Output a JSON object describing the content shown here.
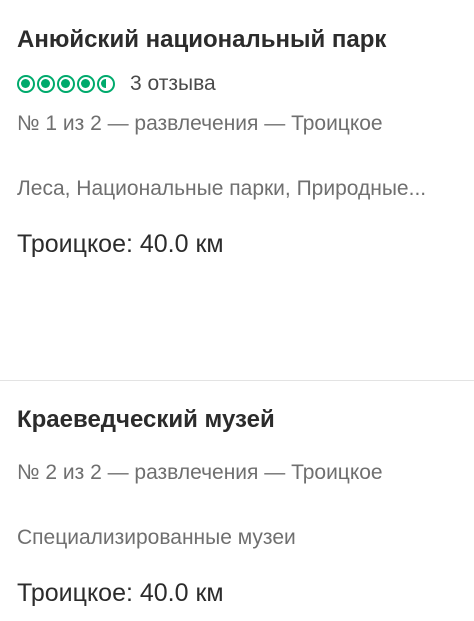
{
  "places": [
    {
      "title": "Анюйский национальный парк",
      "rating": 4.5,
      "rating_max": 5,
      "reviews": "3 отзыва",
      "rank": "№ 1 из 2 — развлечения — Троицкое",
      "tags": "Леса, Национальные парки, Природные...",
      "distance": "Троицкое: 40.0 км"
    },
    {
      "title": "Краеведческий музей",
      "rank": "№ 2 из 2 — развлечения — Троицкое",
      "tags": "Специализированные музеи",
      "distance": "Троицкое: 40.0 км"
    }
  ],
  "colors": {
    "rating_bubble": "#00aa6c",
    "title": "#2c2c2c",
    "secondary_text": "#6f6f6f",
    "divider": "#e3e3e3"
  },
  "icons": [
    "rating-bubble-icon"
  ]
}
